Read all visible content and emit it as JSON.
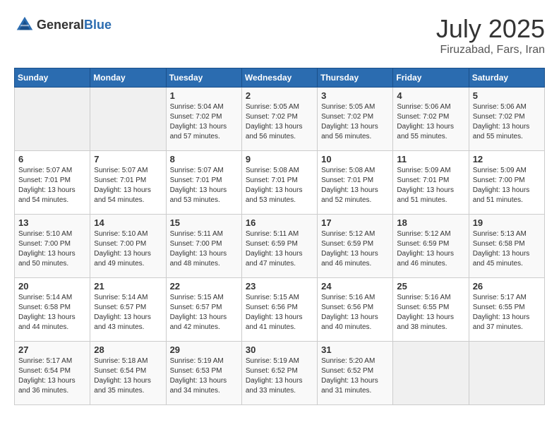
{
  "header": {
    "logo_general": "General",
    "logo_blue": "Blue",
    "month_year": "July 2025",
    "location": "Firuzabad, Fars, Iran"
  },
  "weekdays": [
    "Sunday",
    "Monday",
    "Tuesday",
    "Wednesday",
    "Thursday",
    "Friday",
    "Saturday"
  ],
  "weeks": [
    [
      {
        "day": "",
        "sunrise": "",
        "sunset": "",
        "daylight": ""
      },
      {
        "day": "",
        "sunrise": "",
        "sunset": "",
        "daylight": ""
      },
      {
        "day": "1",
        "sunrise": "Sunrise: 5:04 AM",
        "sunset": "Sunset: 7:02 PM",
        "daylight": "Daylight: 13 hours and 57 minutes."
      },
      {
        "day": "2",
        "sunrise": "Sunrise: 5:05 AM",
        "sunset": "Sunset: 7:02 PM",
        "daylight": "Daylight: 13 hours and 56 minutes."
      },
      {
        "day": "3",
        "sunrise": "Sunrise: 5:05 AM",
        "sunset": "Sunset: 7:02 PM",
        "daylight": "Daylight: 13 hours and 56 minutes."
      },
      {
        "day": "4",
        "sunrise": "Sunrise: 5:06 AM",
        "sunset": "Sunset: 7:02 PM",
        "daylight": "Daylight: 13 hours and 55 minutes."
      },
      {
        "day": "5",
        "sunrise": "Sunrise: 5:06 AM",
        "sunset": "Sunset: 7:02 PM",
        "daylight": "Daylight: 13 hours and 55 minutes."
      }
    ],
    [
      {
        "day": "6",
        "sunrise": "Sunrise: 5:07 AM",
        "sunset": "Sunset: 7:01 PM",
        "daylight": "Daylight: 13 hours and 54 minutes."
      },
      {
        "day": "7",
        "sunrise": "Sunrise: 5:07 AM",
        "sunset": "Sunset: 7:01 PM",
        "daylight": "Daylight: 13 hours and 54 minutes."
      },
      {
        "day": "8",
        "sunrise": "Sunrise: 5:07 AM",
        "sunset": "Sunset: 7:01 PM",
        "daylight": "Daylight: 13 hours and 53 minutes."
      },
      {
        "day": "9",
        "sunrise": "Sunrise: 5:08 AM",
        "sunset": "Sunset: 7:01 PM",
        "daylight": "Daylight: 13 hours and 53 minutes."
      },
      {
        "day": "10",
        "sunrise": "Sunrise: 5:08 AM",
        "sunset": "Sunset: 7:01 PM",
        "daylight": "Daylight: 13 hours and 52 minutes."
      },
      {
        "day": "11",
        "sunrise": "Sunrise: 5:09 AM",
        "sunset": "Sunset: 7:01 PM",
        "daylight": "Daylight: 13 hours and 51 minutes."
      },
      {
        "day": "12",
        "sunrise": "Sunrise: 5:09 AM",
        "sunset": "Sunset: 7:00 PM",
        "daylight": "Daylight: 13 hours and 51 minutes."
      }
    ],
    [
      {
        "day": "13",
        "sunrise": "Sunrise: 5:10 AM",
        "sunset": "Sunset: 7:00 PM",
        "daylight": "Daylight: 13 hours and 50 minutes."
      },
      {
        "day": "14",
        "sunrise": "Sunrise: 5:10 AM",
        "sunset": "Sunset: 7:00 PM",
        "daylight": "Daylight: 13 hours and 49 minutes."
      },
      {
        "day": "15",
        "sunrise": "Sunrise: 5:11 AM",
        "sunset": "Sunset: 7:00 PM",
        "daylight": "Daylight: 13 hours and 48 minutes."
      },
      {
        "day": "16",
        "sunrise": "Sunrise: 5:11 AM",
        "sunset": "Sunset: 6:59 PM",
        "daylight": "Daylight: 13 hours and 47 minutes."
      },
      {
        "day": "17",
        "sunrise": "Sunrise: 5:12 AM",
        "sunset": "Sunset: 6:59 PM",
        "daylight": "Daylight: 13 hours and 46 minutes."
      },
      {
        "day": "18",
        "sunrise": "Sunrise: 5:12 AM",
        "sunset": "Sunset: 6:59 PM",
        "daylight": "Daylight: 13 hours and 46 minutes."
      },
      {
        "day": "19",
        "sunrise": "Sunrise: 5:13 AM",
        "sunset": "Sunset: 6:58 PM",
        "daylight": "Daylight: 13 hours and 45 minutes."
      }
    ],
    [
      {
        "day": "20",
        "sunrise": "Sunrise: 5:14 AM",
        "sunset": "Sunset: 6:58 PM",
        "daylight": "Daylight: 13 hours and 44 minutes."
      },
      {
        "day": "21",
        "sunrise": "Sunrise: 5:14 AM",
        "sunset": "Sunset: 6:57 PM",
        "daylight": "Daylight: 13 hours and 43 minutes."
      },
      {
        "day": "22",
        "sunrise": "Sunrise: 5:15 AM",
        "sunset": "Sunset: 6:57 PM",
        "daylight": "Daylight: 13 hours and 42 minutes."
      },
      {
        "day": "23",
        "sunrise": "Sunrise: 5:15 AM",
        "sunset": "Sunset: 6:56 PM",
        "daylight": "Daylight: 13 hours and 41 minutes."
      },
      {
        "day": "24",
        "sunrise": "Sunrise: 5:16 AM",
        "sunset": "Sunset: 6:56 PM",
        "daylight": "Daylight: 13 hours and 40 minutes."
      },
      {
        "day": "25",
        "sunrise": "Sunrise: 5:16 AM",
        "sunset": "Sunset: 6:55 PM",
        "daylight": "Daylight: 13 hours and 38 minutes."
      },
      {
        "day": "26",
        "sunrise": "Sunrise: 5:17 AM",
        "sunset": "Sunset: 6:55 PM",
        "daylight": "Daylight: 13 hours and 37 minutes."
      }
    ],
    [
      {
        "day": "27",
        "sunrise": "Sunrise: 5:17 AM",
        "sunset": "Sunset: 6:54 PM",
        "daylight": "Daylight: 13 hours and 36 minutes."
      },
      {
        "day": "28",
        "sunrise": "Sunrise: 5:18 AM",
        "sunset": "Sunset: 6:54 PM",
        "daylight": "Daylight: 13 hours and 35 minutes."
      },
      {
        "day": "29",
        "sunrise": "Sunrise: 5:19 AM",
        "sunset": "Sunset: 6:53 PM",
        "daylight": "Daylight: 13 hours and 34 minutes."
      },
      {
        "day": "30",
        "sunrise": "Sunrise: 5:19 AM",
        "sunset": "Sunset: 6:52 PM",
        "daylight": "Daylight: 13 hours and 33 minutes."
      },
      {
        "day": "31",
        "sunrise": "Sunrise: 5:20 AM",
        "sunset": "Sunset: 6:52 PM",
        "daylight": "Daylight: 13 hours and 31 minutes."
      },
      {
        "day": "",
        "sunrise": "",
        "sunset": "",
        "daylight": ""
      },
      {
        "day": "",
        "sunrise": "",
        "sunset": "",
        "daylight": ""
      }
    ]
  ]
}
